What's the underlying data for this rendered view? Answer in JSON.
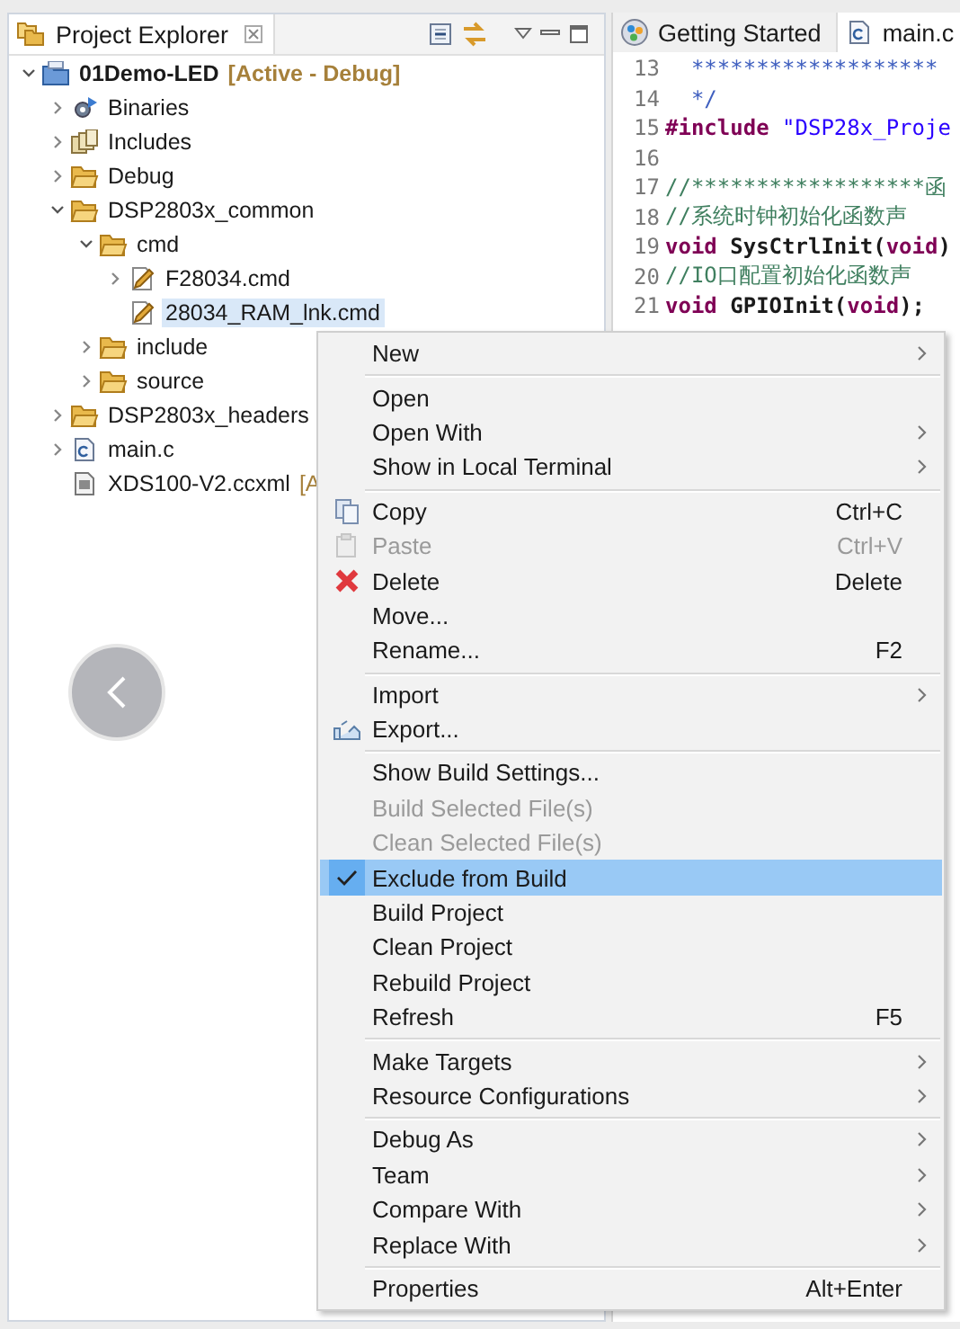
{
  "project_explorer": {
    "title": "Project Explorer",
    "tree": [
      {
        "label": "01Demo-LED",
        "suffix": "[Active - Debug]",
        "kind": "project",
        "expanded": true,
        "selected": false,
        "children": [
          {
            "label": "Binaries",
            "kind": "binaries",
            "expanded": false,
            "selected": false
          },
          {
            "label": "Includes",
            "kind": "includes",
            "expanded": false,
            "selected": false
          },
          {
            "label": "Debug",
            "kind": "folder",
            "expanded": false,
            "selected": false
          },
          {
            "label": "DSP2803x_common",
            "kind": "folder",
            "expanded": true,
            "selected": false,
            "children": [
              {
                "label": "cmd",
                "kind": "folder",
                "expanded": true,
                "selected": false,
                "children": [
                  {
                    "label": "F28034.cmd",
                    "kind": "cmd-file",
                    "expanded": false,
                    "selected": false
                  },
                  {
                    "label": "28034_RAM_lnk.cmd",
                    "kind": "cmd-file",
                    "selected": true
                  }
                ]
              },
              {
                "label": "include",
                "kind": "folder",
                "expanded": false,
                "selected": false
              },
              {
                "label": "source",
                "kind": "folder",
                "expanded": false,
                "selected": false
              }
            ]
          },
          {
            "label": "DSP2803x_headers",
            "kind": "folder",
            "expanded": false,
            "selected": false
          },
          {
            "label": "main.c",
            "kind": "c-file",
            "expanded": false,
            "selected": false
          },
          {
            "label": "XDS100-V2.ccxml",
            "suffix": "[A",
            "kind": "ccxml-file",
            "selected": false
          }
        ]
      }
    ]
  },
  "editor": {
    "tabs": [
      {
        "label": "Getting Started",
        "kind": "welcome",
        "selected": false
      },
      {
        "label": "main.c",
        "kind": "c-file",
        "selected": true
      }
    ],
    "lines": [
      {
        "number": "13",
        "code": [
          {
            "text": "  *******************",
            "kind": "doc"
          }
        ]
      },
      {
        "number": "14",
        "code": [
          {
            "text": "  */",
            "kind": "doc"
          }
        ]
      },
      {
        "number": "15",
        "code": [
          {
            "text": "#include",
            "kind": "keyword"
          },
          {
            "text": " \"DSP28x_Proje",
            "kind": "string"
          }
        ]
      },
      {
        "number": "16"
      },
      {
        "number": "17",
        "code": [
          {
            "text": "//******************函",
            "kind": "comment"
          }
        ]
      },
      {
        "number": "18",
        "code": [
          {
            "text": "//系统时钟初始化函数声",
            "kind": "comment"
          }
        ]
      },
      {
        "number": "19",
        "code": [
          {
            "text": "void",
            "kind": "keyword"
          },
          {
            "text": " SysCtrlInit(",
            "kind": "bold"
          },
          {
            "text": "void",
            "kind": "keyword"
          },
          {
            "text": ")",
            "kind": "bold"
          }
        ]
      },
      {
        "number": "20",
        "code": [
          {
            "text": "//IO口配置初始化函数声",
            "kind": "comment"
          }
        ]
      },
      {
        "number": "21",
        "code": [
          {
            "text": "void",
            "kind": "keyword"
          },
          {
            "text": " GPIOInit(",
            "kind": "bold"
          },
          {
            "text": "void",
            "kind": "keyword"
          },
          {
            "text": ");",
            "kind": "bold"
          }
        ]
      }
    ]
  },
  "context_menu": {
    "items": [
      {
        "kind": "item",
        "label": "New",
        "submenu": true,
        "disabled": false,
        "checked": false,
        "selected": false
      },
      {
        "kind": "separator"
      },
      {
        "kind": "item",
        "label": "Open",
        "submenu": false,
        "disabled": false,
        "checked": false,
        "selected": false
      },
      {
        "kind": "item",
        "label": "Open With",
        "submenu": true,
        "disabled": false,
        "checked": false,
        "selected": false
      },
      {
        "kind": "item",
        "label": "Show in Local Terminal",
        "submenu": true,
        "disabled": false,
        "checked": false,
        "selected": false
      },
      {
        "kind": "separator"
      },
      {
        "kind": "item",
        "label": "Copy",
        "shortcut": "Ctrl+C",
        "submenu": false,
        "disabled": false,
        "checked": false,
        "selected": false
      },
      {
        "kind": "item",
        "label": "Paste",
        "shortcut": "Ctrl+V",
        "submenu": false,
        "disabled": true,
        "checked": false,
        "selected": false
      },
      {
        "kind": "item",
        "label": "Delete",
        "shortcut": "Delete",
        "submenu": false,
        "disabled": false,
        "checked": false,
        "selected": false
      },
      {
        "kind": "item",
        "label": "Move...",
        "submenu": false,
        "disabled": false,
        "checked": false,
        "selected": false
      },
      {
        "kind": "item",
        "label": "Rename...",
        "shortcut": "F2",
        "submenu": false,
        "disabled": false,
        "checked": false,
        "selected": false
      },
      {
        "kind": "separator"
      },
      {
        "kind": "item",
        "label": "Import",
        "submenu": true,
        "disabled": false,
        "checked": false,
        "selected": false
      },
      {
        "kind": "item",
        "label": "Export...",
        "submenu": false,
        "disabled": false,
        "checked": false,
        "selected": false
      },
      {
        "kind": "separator"
      },
      {
        "kind": "item",
        "label": "Show Build Settings...",
        "submenu": false,
        "disabled": false,
        "checked": false,
        "selected": false
      },
      {
        "kind": "item",
        "label": "Build Selected File(s)",
        "submenu": false,
        "disabled": true,
        "checked": false,
        "selected": false
      },
      {
        "kind": "item",
        "label": "Clean Selected File(s)",
        "submenu": false,
        "disabled": true,
        "checked": false,
        "selected": false
      },
      {
        "kind": "item",
        "label": "Exclude from Build",
        "submenu": false,
        "disabled": false,
        "checked": true,
        "selected": true
      },
      {
        "kind": "item",
        "label": "Build Project",
        "submenu": false,
        "disabled": false,
        "checked": false,
        "selected": false
      },
      {
        "kind": "item",
        "label": "Clean Project",
        "submenu": false,
        "disabled": false,
        "checked": false,
        "selected": false
      },
      {
        "kind": "item",
        "label": "Rebuild Project",
        "submenu": false,
        "disabled": false,
        "checked": false,
        "selected": false
      },
      {
        "kind": "item",
        "label": "Refresh",
        "shortcut": "F5",
        "submenu": false,
        "disabled": false,
        "checked": false,
        "selected": false
      },
      {
        "kind": "separator"
      },
      {
        "kind": "item",
        "label": "Make Targets",
        "submenu": true,
        "disabled": false,
        "checked": false,
        "selected": false
      },
      {
        "kind": "item",
        "label": "Resource Configurations",
        "submenu": true,
        "disabled": false,
        "checked": false,
        "selected": false
      },
      {
        "kind": "separator"
      },
      {
        "kind": "item",
        "label": "Debug As",
        "submenu": true,
        "disabled": false,
        "checked": false,
        "selected": false
      },
      {
        "kind": "item",
        "label": "Team",
        "submenu": true,
        "disabled": false,
        "checked": false,
        "selected": false
      },
      {
        "kind": "item",
        "label": "Compare With",
        "submenu": true,
        "disabled": false,
        "checked": false,
        "selected": false
      },
      {
        "kind": "item",
        "label": "Replace With",
        "submenu": true,
        "disabled": false,
        "checked": false,
        "selected": false
      },
      {
        "kind": "separator"
      },
      {
        "kind": "item",
        "label": "Properties",
        "shortcut": "Alt+Enter",
        "submenu": false,
        "disabled": false,
        "checked": false,
        "selected": false
      }
    ]
  }
}
